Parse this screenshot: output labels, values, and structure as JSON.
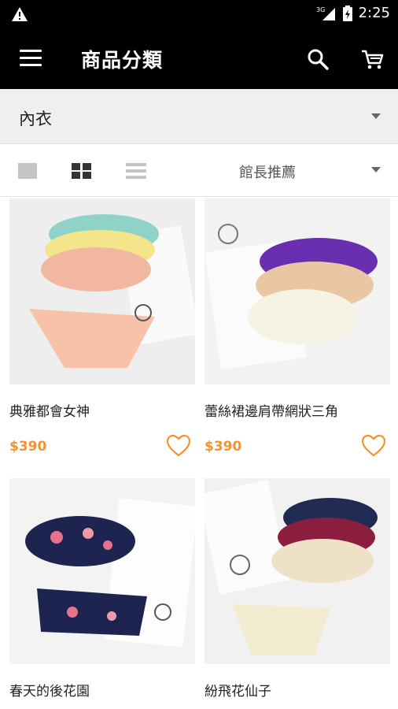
{
  "status_bar": {
    "network": "3G",
    "time": "2:25"
  },
  "app_bar": {
    "title": "商品分類"
  },
  "category_filter": {
    "selected": "內衣"
  },
  "sort": {
    "selected": "館長推薦"
  },
  "products": [
    {
      "name": "典雅都會女神",
      "price": "$390"
    },
    {
      "name": "蕾絲裙邊肩帶網狀三角",
      "price": "$390"
    },
    {
      "name": "春天的後花園",
      "price": ""
    },
    {
      "name": "紛飛花仙子",
      "price": ""
    }
  ],
  "colors": {
    "accent": "#f5922a",
    "appbar": "#000000"
  }
}
